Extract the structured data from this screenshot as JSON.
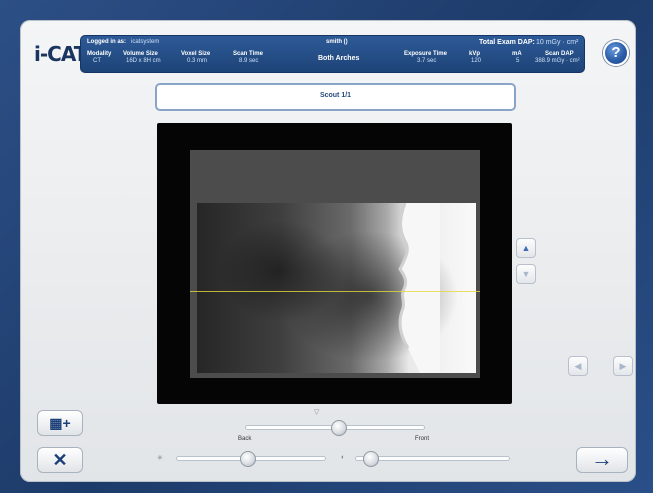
{
  "app": {
    "logo": "i-CAT"
  },
  "header": {
    "logged_in_label": "Logged in as:",
    "logged_in_user": "icatsystem",
    "patient": "smith ()",
    "total_dap_label": "Total Exam DAP:",
    "total_dap_value": "10 mGy · cm²",
    "columns": [
      {
        "label": "Modality",
        "value": "CT"
      },
      {
        "label": "Volume Size",
        "value": "16D x 8H cm"
      },
      {
        "label": "Voxel Size",
        "value": "0.3 mm"
      },
      {
        "label": "Scan Time",
        "value": "8.9 sec"
      },
      {
        "label": "",
        "value": "Both Arches"
      },
      {
        "label": "Exposure Time",
        "value": "3.7 sec"
      },
      {
        "label": "kVp",
        "value": "120"
      },
      {
        "label": "mA",
        "value": "5"
      },
      {
        "label": "Scan DAP",
        "value": "388.9 mGy · cm²"
      }
    ]
  },
  "help": {
    "label": "?"
  },
  "scout": {
    "title": "Scout 1/1"
  },
  "controls": {
    "up_arrow": "▲",
    "down_arrow": "▼",
    "left_arrow": "◀",
    "right_arrow": "▶",
    "position_label_back": "Back",
    "position_label_front": "Front",
    "position_pointer": "▽",
    "brightness_icon": "✳",
    "contrast_icon": "◐",
    "add_grid_icon": "▦+",
    "cancel_icon": "✕",
    "next_icon": "→"
  },
  "sliders": {
    "position": 0.52,
    "brightness": 0.48,
    "contrast": 0.1
  },
  "colors": {
    "frame": "#1d3b6a",
    "info_bar": "#2d5a97",
    "accent": "#3c6eb3",
    "scan_line": "#e4d83a"
  }
}
